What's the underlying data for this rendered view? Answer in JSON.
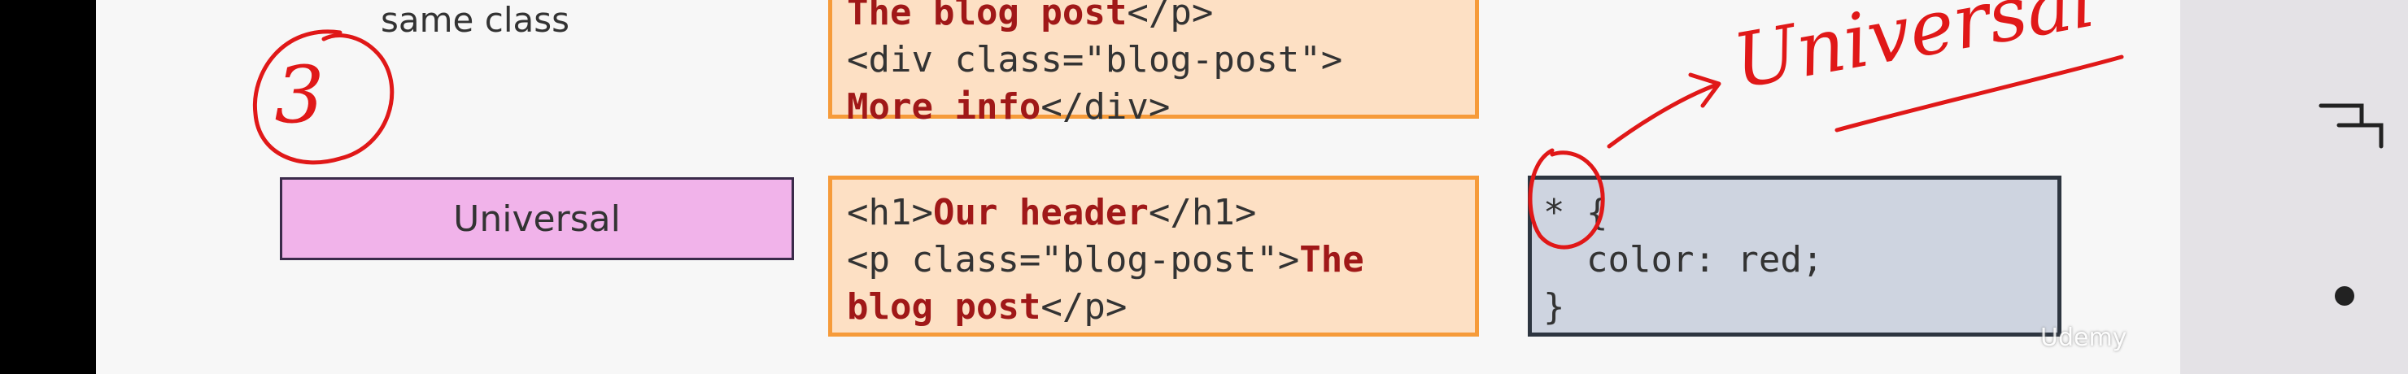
{
  "slide": {
    "class_label": "same class",
    "selector_label": "Universal",
    "code_top": {
      "line1_pre": "",
      "line1_bold": "The blog post",
      "line1_post": "</p>",
      "line2": "<div class=\"blog-post\">",
      "line3_bold": "More info",
      "line3_post": "</div>"
    },
    "code_bottom": {
      "line1_pre": "<h1>",
      "line1_bold": "Our header",
      "line1_post": "</h1>",
      "line2_pre": "<p class=\"blog-post\">",
      "line2_bold": "The",
      "line3_bold": "blog post",
      "line3_post": "</p>"
    },
    "css_code": {
      "line1": "* {",
      "line2": "  color: red;",
      "line3": "}"
    },
    "handwriting": {
      "number": "3",
      "word": "Universal"
    },
    "watermark": "Udemy"
  },
  "colors": {
    "annotation_red": "#e01818",
    "pink_fill": "#f1b3ea",
    "code_fill": "#fde0c4",
    "code_border": "#f69b3a",
    "css_fill": "#ced4e0"
  },
  "side_panel": {
    "icons": [
      "presentation-mode-icon",
      "page-dot-icon"
    ]
  }
}
